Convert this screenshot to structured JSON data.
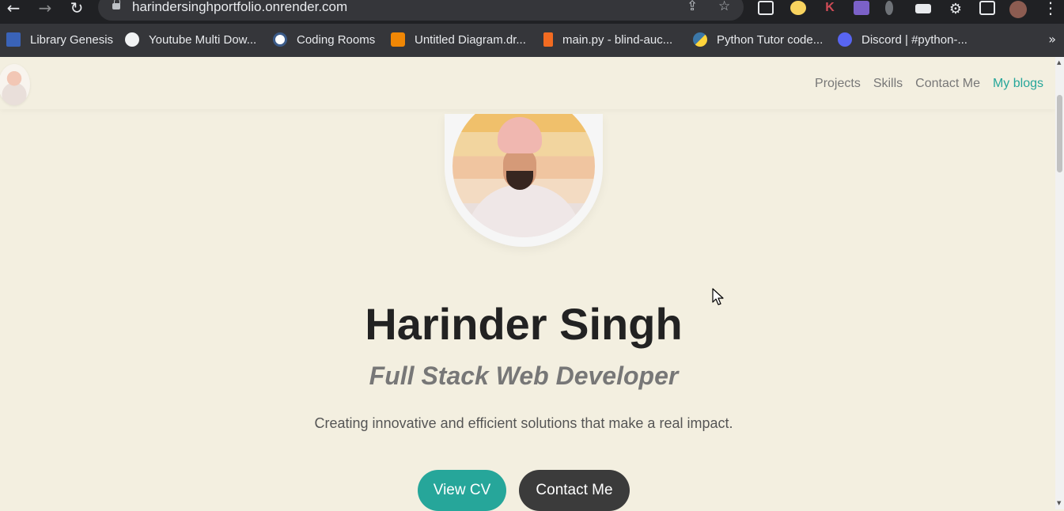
{
  "browser": {
    "url": "harindersinghportfolio.onrender.com",
    "icons": {
      "back": "arrow-left-icon",
      "forward": "arrow-right-icon",
      "reload": "refresh-icon",
      "share": "share-icon",
      "star": "bookmark-star-icon",
      "menu": "kebab-menu-icon"
    }
  },
  "bookmarks": [
    {
      "label": "Library Genesis",
      "color": "#3a63b8"
    },
    {
      "label": "Youtube Multi Dow...",
      "color": "#f1f3f4"
    },
    {
      "label": "Coding Rooms",
      "color": "#ffffff"
    },
    {
      "label": "Untitled Diagram.dr...",
      "color": "#f08705"
    },
    {
      "label": "main.py - blind-auc...",
      "color": "#f26b21"
    },
    {
      "label": "Python Tutor code...",
      "color": "#3b77a8"
    },
    {
      "label": "Discord | #python-...",
      "color": "#5865f2"
    }
  ],
  "site": {
    "nav": [
      {
        "label": "Projects"
      },
      {
        "label": "Skills"
      },
      {
        "label": "Contact Me"
      },
      {
        "label": "My blogs"
      }
    ],
    "hero": {
      "name": "Harinder Singh",
      "role": "Full Stack Web Developer",
      "tagline": "Creating innovative and efficient solutions that make a real impact.",
      "primary_button": "View CV",
      "secondary_button": "Contact Me"
    }
  },
  "colors": {
    "background": "#f3efe0",
    "accent": "#26a69a",
    "dark_button": "#3b3b3b",
    "text": "#222222"
  }
}
